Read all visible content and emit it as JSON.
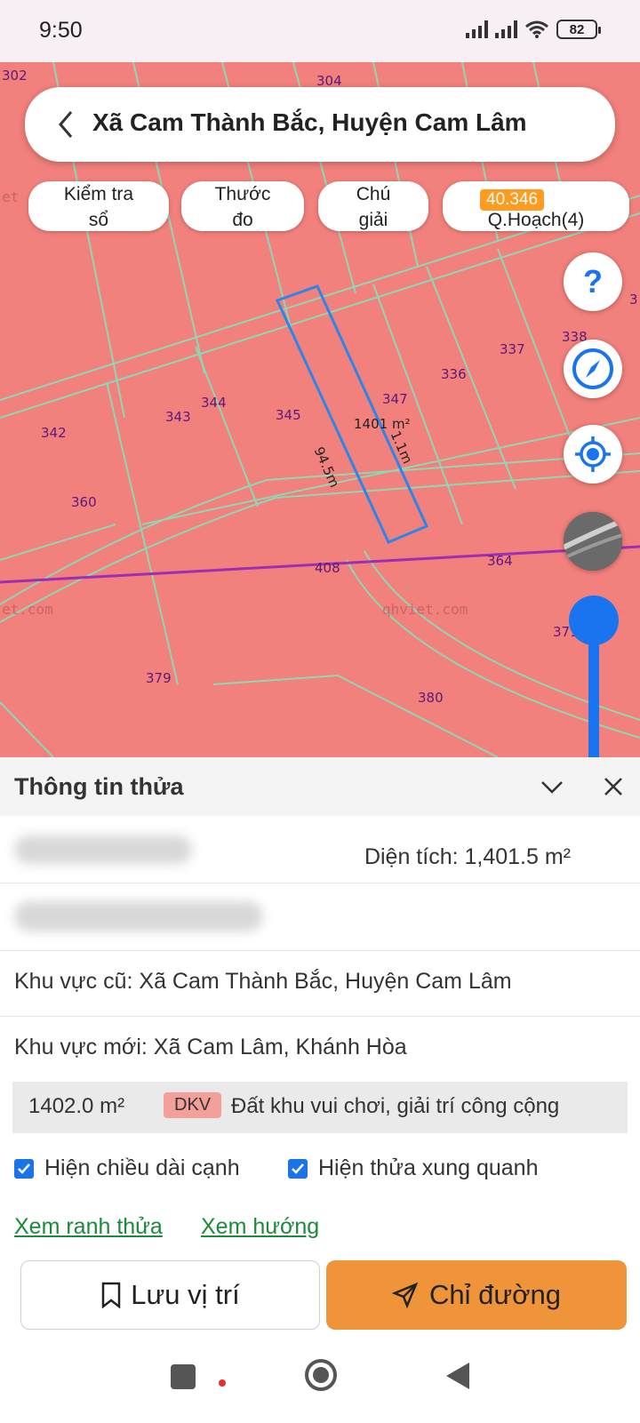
{
  "status_bar": {
    "time": "9:50",
    "battery": "82"
  },
  "header": {
    "title": "Xã Cam Thành Bắc, Huyện Cam Lâm"
  },
  "chips": [
    {
      "line1": "Kiểm tra",
      "line2": "sổ"
    },
    {
      "line1": "Thước",
      "line2": "đo"
    },
    {
      "line1": "Chú",
      "line2": "giải"
    },
    {
      "line1": "",
      "line2": "Q.Hoạch(4)"
    }
  ],
  "chip_badge": "40.346",
  "map": {
    "parcel_labels": [
      "302",
      "304",
      "337",
      "338",
      "336",
      "347",
      "344",
      "343",
      "345",
      "342",
      "360",
      "408",
      "364",
      "371",
      "379",
      "380",
      "3"
    ],
    "measure_area": "1401 m²",
    "measure_side_long": "94.5m",
    "measure_side_short": "1.1m",
    "watermarks": [
      "et.com",
      "qhviet.com",
      "et"
    ],
    "colors": {
      "zone": "#f2807c",
      "parcel_lines": "#8fd6b4",
      "selected_parcel": "#2b86e8",
      "boundary": "#9b2fb5"
    }
  },
  "panel": {
    "title": "Thông tin thửa",
    "area_label": "Diện tích: 1,401.5 m²",
    "old_region": "Khu vực cũ: Xã Cam Thành Bắc, Huyện Cam Lâm",
    "new_region": "Khu vực mới: Xã Cam Lâm, Khánh Hòa",
    "land_use": {
      "area": "1402.0 m²",
      "code": "DKV",
      "name": "Đất khu vui chơi, giải trí công cộng"
    },
    "checkboxes": [
      {
        "label": "Hiện chiều dài cạnh",
        "checked": true
      },
      {
        "label": "Hiện thửa xung quanh",
        "checked": true
      }
    ],
    "links": [
      "Xem ranh thửa",
      "Xem hướng"
    ],
    "save_button": "Lưu vị trí",
    "directions_button": "Chỉ đường"
  }
}
